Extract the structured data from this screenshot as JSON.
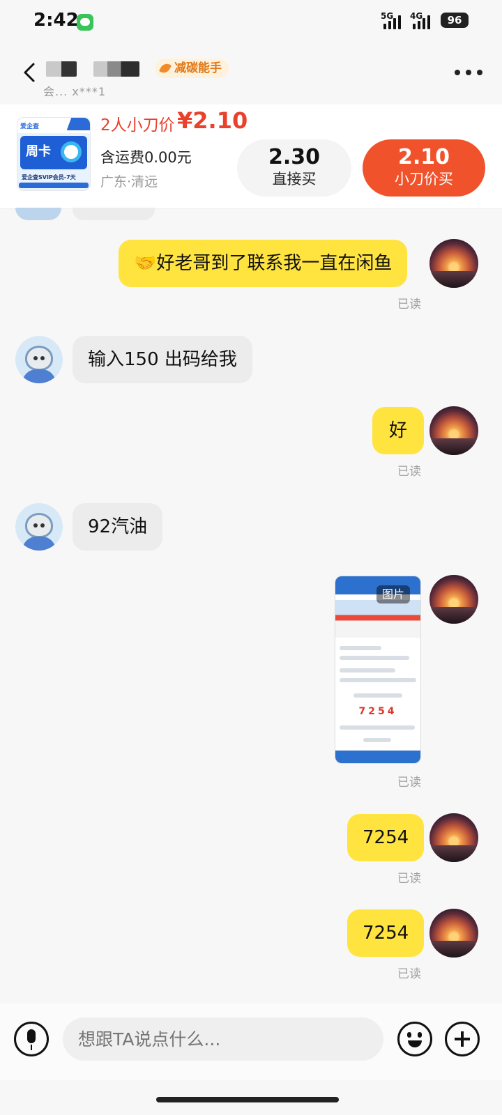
{
  "status_bar": {
    "time": "2:42",
    "network_1": "5G",
    "network_2": "4G",
    "battery": "96"
  },
  "header": {
    "subtitle": "会... x***1",
    "badge": "减碳能手"
  },
  "product": {
    "thumb_brand": "爱企查",
    "thumb_title": "周卡",
    "thumb_caption": "爱企查SVIP会员-7天",
    "deal_label": "2人小刀价",
    "deal_price": "¥2.10",
    "shipping": "含运费0.00元",
    "location": "广东·清远",
    "buy_price": "2.30",
    "buy_label": "直接买",
    "knife_price": "2.10",
    "knife_label": "小刀价买"
  },
  "messages": [
    {
      "from": "me",
      "text": "🤝好老哥到了联系我一直在闲鱼",
      "status": "已读"
    },
    {
      "from": "other",
      "text": "输入150 出码给我"
    },
    {
      "from": "me",
      "text": "好",
      "status": "已读"
    },
    {
      "from": "other",
      "text": "92汽油"
    },
    {
      "from": "me",
      "type": "image",
      "tag": "图片",
      "image_code": "7254",
      "status": "已读"
    },
    {
      "from": "me",
      "text": "7254",
      "status": "已读"
    },
    {
      "from": "me",
      "text": "7254",
      "status": "已读"
    }
  ],
  "input": {
    "placeholder": "想跟TA说点什么..."
  }
}
